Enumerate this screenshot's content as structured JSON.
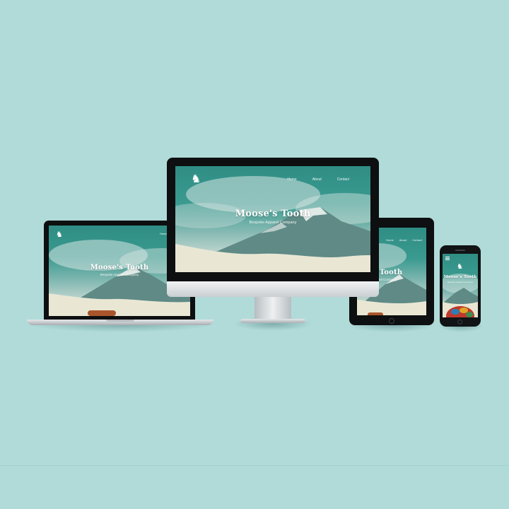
{
  "site": {
    "title": "Moose's Tooth",
    "subtitle": "Bespoke Apparel Company",
    "nav": [
      "Home",
      "About",
      "Contact"
    ]
  },
  "colors": {
    "background": "#b0dbd9",
    "sky": "#2f8d84",
    "cloud": "#d9e6e3",
    "mountain": "#5f8a86",
    "snow": "#e9e7d4"
  },
  "icons": {
    "logo": "moose-logo-icon",
    "menu": "hamburger-menu-icon",
    "home_button": "home-button-icon",
    "camera": "camera-icon"
  }
}
